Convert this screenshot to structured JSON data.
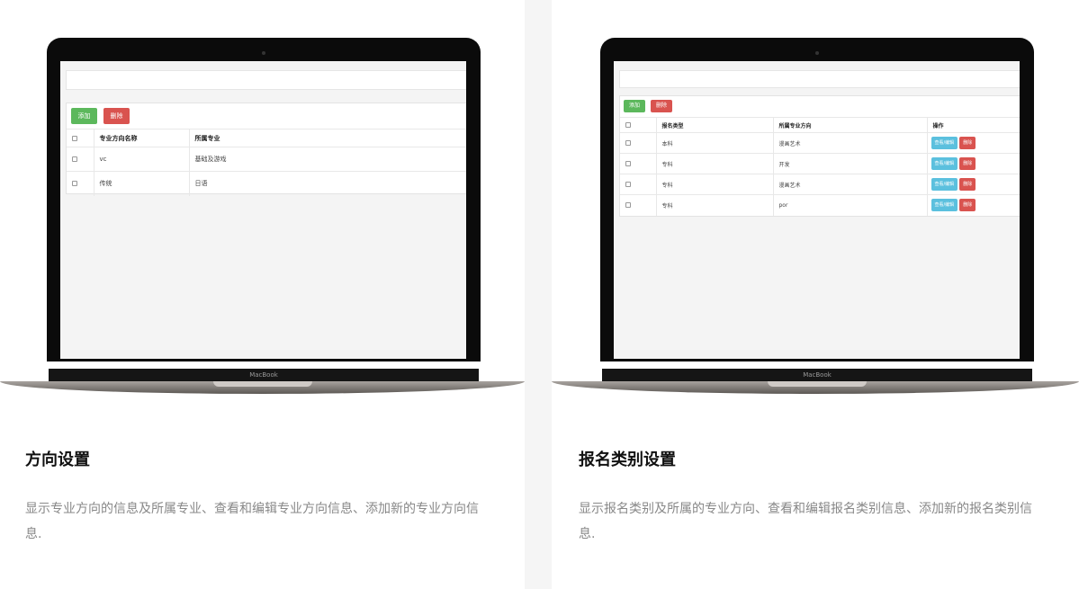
{
  "left": {
    "brand": "MacBook",
    "add_label": "添加",
    "delete_label": "删除",
    "headers": [
      "专业方向名称",
      "所属专业"
    ],
    "rows": [
      [
        "vc",
        "基础及游戏"
      ],
      [
        "传统",
        "日语"
      ]
    ],
    "title": "方向设置",
    "desc": "显示专业方向的信息及所属专业、查看和编辑专业方向信息、添加新的专业方向信息."
  },
  "right": {
    "brand": "MacBook",
    "add_label": "添加",
    "delete_label": "删除",
    "headers": [
      "报名类型",
      "所属专业方向",
      "操作"
    ],
    "rows": [
      [
        "本科",
        "漫画艺术"
      ],
      [
        "专科",
        "开发"
      ],
      [
        "专科",
        "漫画艺术"
      ],
      [
        "专科",
        "por"
      ]
    ],
    "view_edit_label": "查看/编辑",
    "row_delete_label": "删除",
    "title": "报名类别设置",
    "desc": "显示报名类别及所属的专业方向、查看和编辑报名类别信息、添加新的报名类别信息."
  },
  "colors": {
    "green": "#5cb85c",
    "red": "#d9534f",
    "blue": "#5bc0de"
  }
}
